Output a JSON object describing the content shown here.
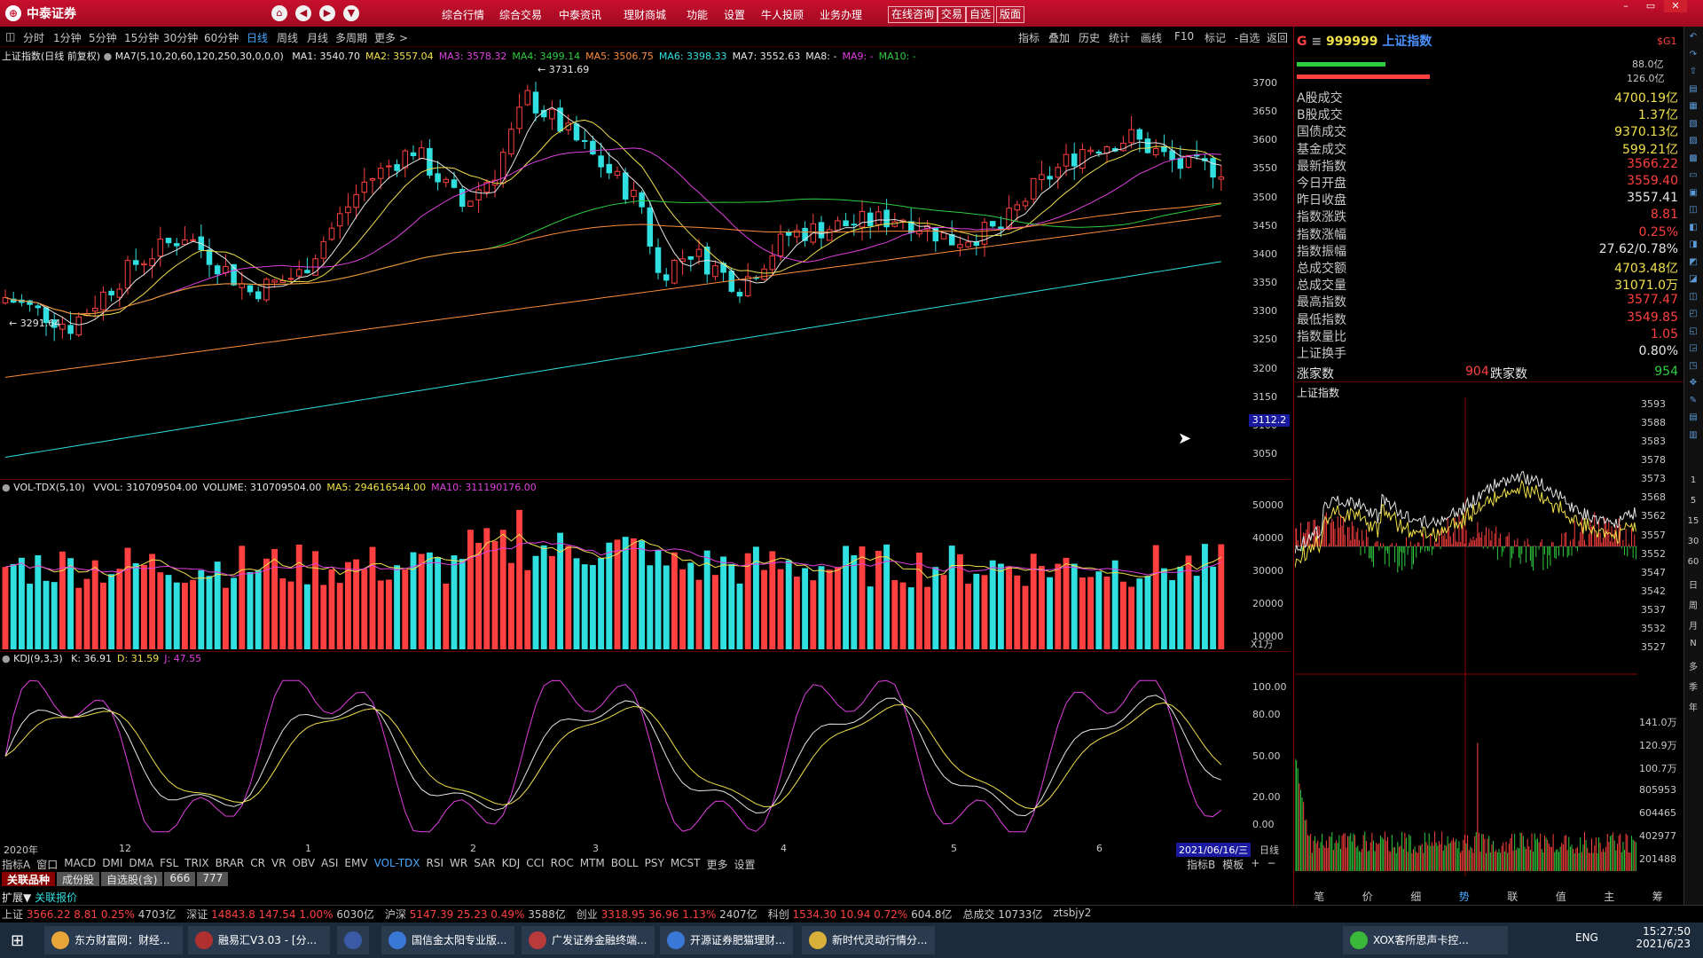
{
  "app": {
    "title": "中泰证券",
    "menus": [
      "综合行情",
      "综合交易",
      "中泰资讯",
      "理财商城",
      "功能",
      "设置",
      "牛人投顾",
      "业务办理"
    ],
    "title_buttons": [
      "在线咨询",
      "交易",
      "自选",
      "版面"
    ]
  },
  "toolbar": {
    "periods": [
      "分时",
      "1分钟",
      "5分钟",
      "15分钟",
      "30分钟",
      "60分钟",
      "日线",
      "周线",
      "月线",
      "多周期",
      "更多 >"
    ],
    "active_period": "日线",
    "right_tools": [
      "指标",
      "叠加",
      "历史",
      "统计",
      "画线",
      "F10",
      "标记",
      "-自选",
      "返回"
    ]
  },
  "main_chart": {
    "header_name": "上证指数(日线 前复权)",
    "ma_params": "MA7(5,10,20,60,120,250,30,0,0,0)",
    "ma_values": [
      {
        "label": "MA1: 3540.70",
        "color": "#e6e6e6"
      },
      {
        "label": "MA2: 3557.04",
        "color": "#f0e04a"
      },
      {
        "label": "MA3: 3578.32",
        "color": "#e040e0"
      },
      {
        "label": "MA4: 3499.14",
        "color": "#2ecc40"
      },
      {
        "label": "MA5: 3506.75",
        "color": "#ff8c3a"
      },
      {
        "label": "MA6: 3398.33",
        "color": "#30e0e0"
      },
      {
        "label": "MA7: 3552.63",
        "color": "#e6e6e6"
      },
      {
        "label": "MA8: -",
        "color": "#e6e6e6"
      },
      {
        "label": "MA9: -",
        "color": "#e040e0"
      },
      {
        "label": "MA10: -",
        "color": "#2ecc40"
      }
    ],
    "y_axis": [
      "3700",
      "3650",
      "3600",
      "3550",
      "3500",
      "3450",
      "3400",
      "3350",
      "3300",
      "3250",
      "3200",
      "3150",
      "3100",
      "3050"
    ],
    "high_label": "3731.69",
    "low_label": "3291.64",
    "cursor_price": "3112.2"
  },
  "volume_panel": {
    "header": "VOL-TDX(5,10)",
    "values": [
      {
        "label": "VVOL: 310709504.00",
        "color": "#e6e6e6"
      },
      {
        "label": "VOLUME: 310709504.00",
        "color": "#e6e6e6"
      },
      {
        "label": "MA5: 294616544.00",
        "color": "#f0e04a"
      },
      {
        "label": "MA10: 311190176.00",
        "color": "#e040e0"
      }
    ],
    "y_axis": [
      "50000",
      "40000",
      "30000",
      "20000",
      "10000"
    ],
    "unit": "X1万"
  },
  "kdj_panel": {
    "header": "KDJ(9,3,3)",
    "values": [
      {
        "label": "K: 36.91",
        "color": "#e6e6e6"
      },
      {
        "label": "D: 31.59",
        "color": "#f0e04a"
      },
      {
        "label": "J: 47.55",
        "color": "#e040e0"
      }
    ],
    "y_axis": [
      "100.00",
      "80.00",
      "50.00",
      "20.00",
      "0.00"
    ]
  },
  "time_axis": {
    "labels": [
      "2020年",
      "12",
      "1",
      "2",
      "3",
      "4",
      "5",
      "6"
    ],
    "current_date": "2021/06/16/三",
    "period_label": "日线"
  },
  "indicator_tabs": [
    "指标A",
    "窗口",
    "MACD",
    "DMI",
    "DMA",
    "FSL",
    "TRIX",
    "BRAR",
    "CR",
    "VR",
    "OBV",
    "ASI",
    "EMV",
    "VOL-TDX",
    "RSI",
    "WR",
    "SAR",
    "KDJ",
    "CCI",
    "ROC",
    "MTM",
    "BOLL",
    "PSY",
    "MCST",
    "更多",
    "设置"
  ],
  "active_indicator": "VOL-TDX",
  "indicator_right": [
    "指标B",
    "模板",
    "+",
    "−"
  ],
  "bottom_tabs": [
    "关联品种",
    "成份股",
    "自选股(含)",
    "666",
    "777"
  ],
  "expand_row": [
    "扩展▼",
    "关联报价"
  ],
  "quote_panel": {
    "code": "999999",
    "name": "上证指数",
    "badge": "$G1",
    "bar_values": [
      "88.0亿",
      "126.0亿"
    ],
    "rows": [
      {
        "label": "A股成交",
        "value": "4700.19亿",
        "color": "#f0e04a"
      },
      {
        "label": "B股成交",
        "value": "1.37亿",
        "color": "#f0e04a"
      },
      {
        "label": "国债成交",
        "value": "9370.13亿",
        "color": "#f0e04a"
      },
      {
        "label": "基金成交",
        "value": "599.21亿",
        "color": "#f0e04a"
      },
      {
        "label": "最新指数",
        "value": "3566.22",
        "color": "#ff4040"
      },
      {
        "label": "今日开盘",
        "value": "3559.40",
        "color": "#ff4040"
      },
      {
        "label": "昨日收盘",
        "value": "3557.41",
        "color": "#e6e6e6"
      },
      {
        "label": "指数涨跌",
        "value": "8.81",
        "color": "#ff4040"
      },
      {
        "label": "指数涨幅",
        "value": "0.25%",
        "color": "#ff4040"
      },
      {
        "label": "指数振幅",
        "value": "27.62/0.78%",
        "color": "#e6e6e6"
      },
      {
        "label": "总成交额",
        "value": "4703.48亿",
        "color": "#f0e04a"
      },
      {
        "label": "总成交量",
        "value": "31071.0万",
        "color": "#f0e04a"
      },
      {
        "label": "最高指数",
        "value": "3577.47",
        "color": "#ff4040"
      },
      {
        "label": "最低指数",
        "value": "3549.85",
        "color": "#ff4040"
      },
      {
        "label": "指数量比",
        "value": "1.05",
        "color": "#ff4040"
      },
      {
        "label": "上证换手",
        "value": "0.80%",
        "color": "#e6e6e6"
      }
    ],
    "up_label": "涨家数",
    "up_count": "904",
    "down_label": "跌家数",
    "down_count": "954",
    "mini_title": "上证指数",
    "mini_price_axis": [
      "3593",
      "3588",
      "3583",
      "3578",
      "3573",
      "3568",
      "3562",
      "3557",
      "3552",
      "3547",
      "3542",
      "3537",
      "3532",
      "3527"
    ],
    "mini_vol_axis": [
      "141.0万",
      "120.9万",
      "100.7万",
      "805953",
      "604465",
      "402977",
      "201488"
    ],
    "bottom_tabs": [
      "笔",
      "价",
      "细",
      "势",
      "联",
      "值",
      "主",
      "筹"
    ],
    "active_bottom_tab": "势"
  },
  "side_icons": [
    "1",
    "5",
    "15",
    "30",
    "60",
    "日",
    "周",
    "月",
    "N",
    "多",
    "季",
    "年"
  ],
  "status_bar": [
    {
      "name": "上证",
      "price": "3566.22",
      "chg": "8.81",
      "pct": "0.25%",
      "amt": "4703亿"
    },
    {
      "name": "深证",
      "price": "14843.8",
      "chg": "147.54",
      "pct": "1.00%",
      "amt": "6030亿"
    },
    {
      "name": "沪深",
      "price": "5147.39",
      "chg": "25.23",
      "pct": "0.49%",
      "amt": "3588亿"
    },
    {
      "name": "创业",
      "price": "3318.95",
      "chg": "36.96",
      "pct": "1.13%",
      "amt": "2407亿"
    },
    {
      "name": "科创",
      "price": "1534.30",
      "chg": "10.94",
      "pct": "0.72%",
      "amt": "604.8亿"
    }
  ],
  "status_total_label": "总成交",
  "status_total": "10733亿",
  "status_user": "ztsbjy2",
  "taskbar": {
    "items": [
      "东方财富网：财经...",
      "融易汇V3.03 - [分...",
      "",
      "国信金太阳专业版...",
      "广发证券金融终端...",
      "开源证券肥猫理财...",
      "新时代灵动行情分...",
      "XOX客所思声卡控..."
    ],
    "lang": "ENG",
    "time": "15:27:50",
    "date": "2021/6/23"
  },
  "colors": {
    "up": "#ff4040",
    "down": "#30e0e0",
    "accent": "#c8102e"
  }
}
